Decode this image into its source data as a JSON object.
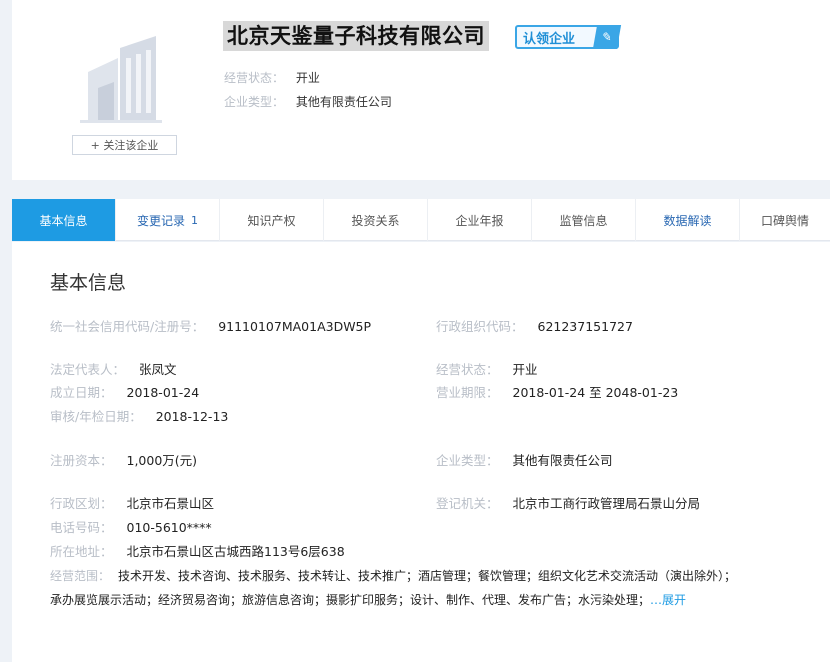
{
  "company": {
    "name": "北京天鉴量子科技有限公司",
    "claim_badge": "认领企业",
    "claim_badge_icon": "edit-tag-icon",
    "follow_label": "+ 关注该企业",
    "meta": [
      {
        "key": "经营状态：",
        "value": "开业"
      },
      {
        "key": "企业类型：",
        "value": "其他有限责任公司"
      }
    ]
  },
  "tabs": [
    {
      "label": "基本信息",
      "active": true
    },
    {
      "label": "变更记录",
      "count": "1"
    },
    {
      "label": "知识产权"
    },
    {
      "label": "投资关系"
    },
    {
      "label": "企业年报"
    },
    {
      "label": "监管信息"
    },
    {
      "label": "数据解读"
    },
    {
      "label": "口碑舆情"
    }
  ],
  "basic_info": {
    "title": "基本信息",
    "fields": {
      "credit_code": {
        "key": "统一社会信用代码/注册号：",
        "value": "91110107MA01A3DW5P"
      },
      "org_code": {
        "key": "行政组织代码：",
        "value": "621237151727"
      },
      "legal_rep": {
        "key": "法定代表人：",
        "value": "张凤文"
      },
      "status": {
        "key": "经营状态：",
        "value": "开业"
      },
      "founded": {
        "key": "成立日期：",
        "value": "2018-01-24"
      },
      "term": {
        "key": "营业期限：",
        "value": "2018-01-24 至 2048-01-23"
      },
      "approved": {
        "key": "审核/年检日期：",
        "value": "2018-12-13"
      },
      "capital": {
        "key": "注册资本：",
        "value": "1,000万(元)"
      },
      "type": {
        "key": "企业类型：",
        "value": "其他有限责任公司"
      },
      "district": {
        "key": "行政区划：",
        "value": "北京市石景山区"
      },
      "registry": {
        "key": "登记机关：",
        "value": "北京市工商行政管理局石景山分局"
      },
      "phone": {
        "key": "电话号码：",
        "value": "010-5610****"
      },
      "address": {
        "key": "所在地址：",
        "value": "北京市石景山区古城西路113号6层638"
      }
    },
    "scope_key": "经营范围：",
    "scope_line1": "技术开发、技术咨询、技术服务、技术转让、技术推广；酒店管理；餐饮管理；组织文化艺术交流活动（演出除外）；",
    "scope_line2": "承办展览展示活动；经济贸易咨询；旅游信息咨询；摄影扩印服务；设计、制作、代理、发布广告；水污染处理；",
    "expand_label": "…展开"
  }
}
